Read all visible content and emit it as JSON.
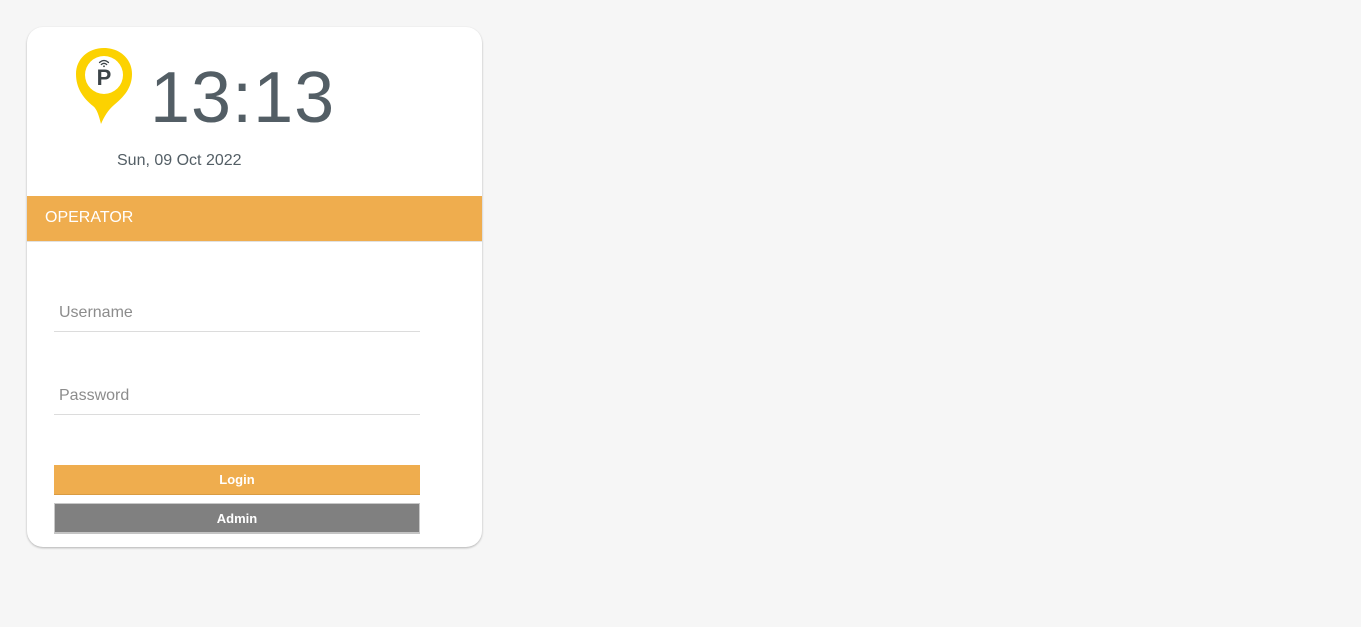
{
  "header": {
    "logo_icon": "parking-pin-icon",
    "logo_letter": "P",
    "time": "13:13",
    "date": "Sun, 09 Oct 2022"
  },
  "role": {
    "label": "OPERATOR"
  },
  "form": {
    "username": {
      "value": "",
      "placeholder": "Username"
    },
    "password": {
      "value": "",
      "placeholder": "Password"
    },
    "login_label": "Login",
    "admin_label": "Admin"
  },
  "colors": {
    "accent": "#efad4e",
    "logo_yellow": "#fcd200",
    "text": "#535e65",
    "secondary_button": "#808080",
    "background": "#f6f6f6"
  }
}
